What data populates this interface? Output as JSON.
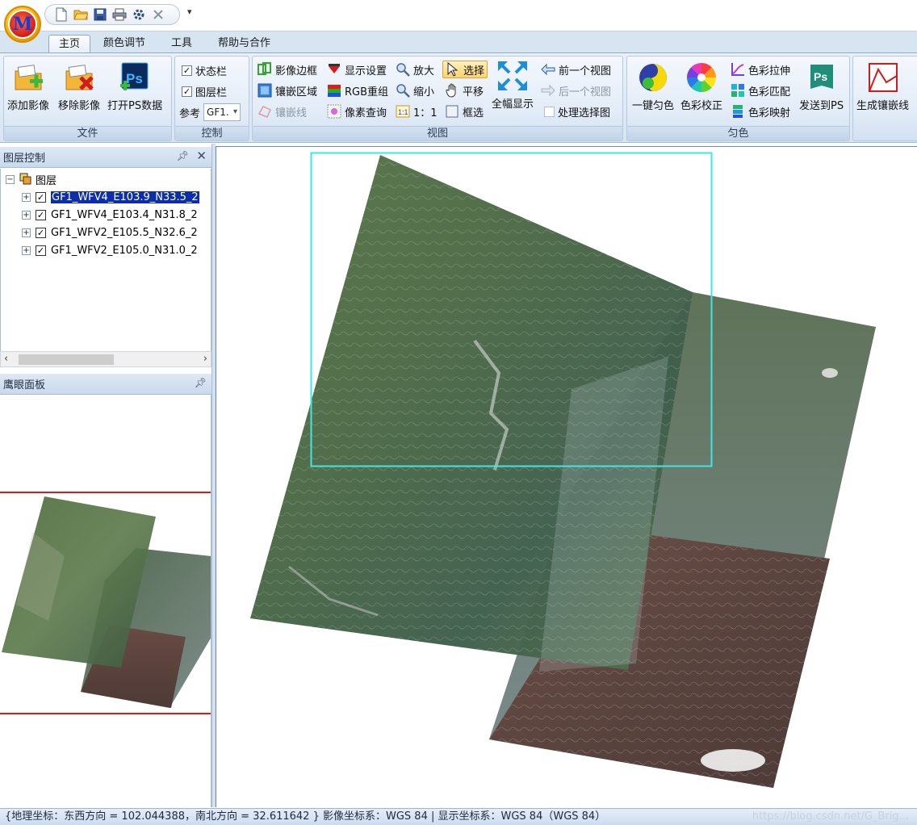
{
  "app": {
    "logo_letter": "M"
  },
  "quick_access": {
    "icons": [
      "new-file-icon",
      "open-folder-icon",
      "save-icon",
      "print-icon",
      "settings-icon",
      "close-icon"
    ],
    "dropdown": "▾"
  },
  "tabs": [
    {
      "label": "主页",
      "active": true
    },
    {
      "label": "颜色调节",
      "active": false
    },
    {
      "label": "工具",
      "active": false
    },
    {
      "label": "帮助与合作",
      "active": false
    }
  ],
  "ribbon": {
    "file": {
      "label": "文件",
      "add": "添加影像",
      "remove": "移除影像",
      "open_ps": "打开PS数据"
    },
    "control": {
      "label": "控制",
      "statusbar": "状态栏",
      "layerbar": "图层栏",
      "ref_label": "参考",
      "ref_value": "GF1."
    },
    "view": {
      "label": "视图",
      "image_border": "影像边框",
      "display_settings": "显示设置",
      "zoom_in": "放大",
      "select": "选择",
      "prev_view": "前一个视图",
      "mosaic_area": "镶嵌区域",
      "rgb": "RGB重组",
      "zoom_out": "缩小",
      "pan": "平移",
      "next_view": "后一个视图",
      "mosaic_line": "镶嵌线",
      "pixel_query": "像素查询",
      "one_to_one": "1：1",
      "box_select": "框选",
      "full_extent": "全幅显示",
      "process_selection": "处理选择图"
    },
    "color": {
      "label": "匀色",
      "one_key": "一键匀色",
      "correction": "色彩校正",
      "stretch": "色彩拉伸",
      "match": "色彩匹配",
      "mapping": "色彩映射",
      "send_ps": "发送到PS"
    },
    "mosaic": {
      "generate": "生成镶嵌线"
    }
  },
  "layer_panel": {
    "title": "图层控制",
    "root": "图层",
    "layers": [
      {
        "name": "GF1_WFV4_E103.9_N33.5_2",
        "checked": true,
        "selected": true
      },
      {
        "name": "GF1_WFV4_E103.4_N31.8_2",
        "checked": true,
        "selected": false
      },
      {
        "name": "GF1_WFV2_E105.5_N32.6_2",
        "checked": true,
        "selected": false
      },
      {
        "name": "GF1_WFV2_E105.0_N31.0_2",
        "checked": true,
        "selected": false
      }
    ]
  },
  "eagle_panel": {
    "title": "鹰眼面板"
  },
  "status": {
    "text": "{地理坐标：东西方向 = 102.044388，南北方向 = 32.611642 } 影像坐标系：WGS 84 | 显示坐标系：WGS 84（WGS 84）",
    "watermark": "https://blog.csdn.net/G_Brig..."
  },
  "colors": {
    "ribbon_bg": "#dbe7f4",
    "selection": "#0c2ea8",
    "viewport_box": "#3ee6e6",
    "eagle_box": "#e01818"
  }
}
